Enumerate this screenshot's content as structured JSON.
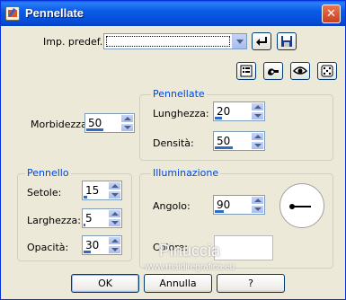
{
  "window": {
    "title": "Pennellate",
    "close_glyph": "✕"
  },
  "preset": {
    "label": "Imp. predef.:",
    "value": ""
  },
  "toolbar": {
    "icons": [
      "apply-preset-icon",
      "save-preset-icon",
      "reset-list-icon",
      "proof-hand-icon",
      "eye-preview-icon",
      "random-dice-icon"
    ]
  },
  "morbidezza": {
    "label": "Morbidezza:",
    "value": "50",
    "fill": 0.5
  },
  "pennellate": {
    "title": "Pennellate",
    "lunghezza": {
      "label": "Lunghezza:",
      "value": "20",
      "fill": 0.2
    },
    "densita": {
      "label": "Densità:",
      "value": "50",
      "fill": 0.5
    }
  },
  "pennello": {
    "title": "Pennello",
    "setole": {
      "label": "Setole:",
      "value": "15",
      "fill": 0.15
    },
    "larghezza": {
      "label": "Larghezza:",
      "value": "5",
      "fill": 0.05
    },
    "opacita": {
      "label": "Opacità:",
      "value": "30",
      "fill": 0.3
    }
  },
  "illuminazione": {
    "title": "Illuminazione",
    "angolo": {
      "label": "Angolo:",
      "value": "90",
      "fill": 0.25
    },
    "colore": {
      "label": "Colore:",
      "swatch": "#ffffff"
    }
  },
  "watermark": {
    "name": "Pinuccia",
    "url": "www.maidiregrafica.eu"
  },
  "buttons": {
    "ok": "OK",
    "cancel": "Annulla",
    "help": "?"
  },
  "colors": {
    "titlebar": "#0a5ce8",
    "accent": "#0046d5",
    "dialog_bg": "#ece9d8"
  }
}
